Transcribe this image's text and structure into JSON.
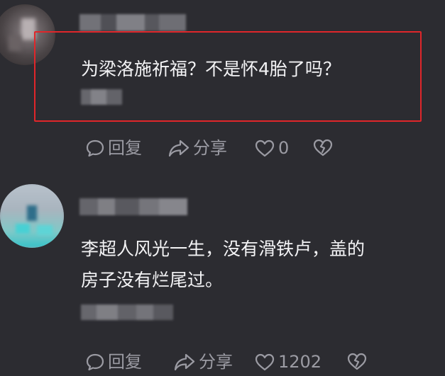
{
  "comments": [
    {
      "text": "为梁洛施祈福？不是怀4胎了吗？",
      "actions": {
        "reply_label": "回复",
        "share_label": "分享",
        "like_count": "0"
      }
    },
    {
      "text_line1": "李超人风光一生，没有滑铁卢，盖的",
      "text_line2": "房子没有烂尾过。",
      "actions": {
        "reply_label": "回复",
        "share_label": "分享",
        "like_count": "1202"
      }
    }
  ],
  "colors": {
    "background": "#2c2c31",
    "text": "#f3f3f5",
    "action_text": "#9b9ba3",
    "highlight_border": "#e0262a"
  },
  "icons": {
    "reply": "comment-bubble-icon",
    "share": "share-arrow-icon",
    "like": "heart-outline-icon",
    "dislike": "broken-heart-icon"
  }
}
